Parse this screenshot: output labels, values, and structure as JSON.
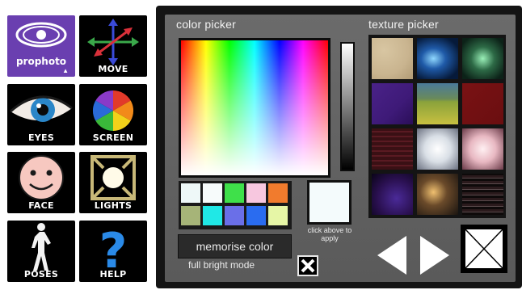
{
  "tools": [
    {
      "id": "prophoto",
      "label": "prophoto",
      "icon": "eye-logo-icon"
    },
    {
      "id": "move",
      "label": "MOVE",
      "icon": "move-arrows-icon"
    },
    {
      "id": "eyes",
      "label": "EYES",
      "icon": "eye-icon"
    },
    {
      "id": "screen",
      "label": "SCREEN",
      "icon": "color-wheel-icon"
    },
    {
      "id": "face",
      "label": "FACE",
      "icon": "smiley-face-icon"
    },
    {
      "id": "lights",
      "label": "LIGHTS",
      "icon": "spotlight-icon"
    },
    {
      "id": "poses",
      "label": "POSES",
      "icon": "figure-icon"
    },
    {
      "id": "help",
      "label": "HELP",
      "icon": "question-mark-icon"
    }
  ],
  "color_picker": {
    "title": "color picker",
    "memorise_label": "memorise color",
    "apply_hint": "click above to apply",
    "bright_mode_label": "full bright mode",
    "selected_color": "#f4fbfc",
    "swatches": [
      "#eef8f8",
      "#f7fbfb",
      "#3fe04a",
      "#f7c7df",
      "#f17b2d",
      "#a6b478",
      "#20e8e6",
      "#6a6fe8",
      "#2a6cf0",
      "#e6f6a6"
    ]
  },
  "texture_picker": {
    "title": "texture picker",
    "textures": [
      {
        "name": "sand",
        "color": "#c9b48f"
      },
      {
        "name": "blue-swirl",
        "color": "#1f5aa8"
      },
      {
        "name": "green-smoke",
        "color": "#2d6a46"
      },
      {
        "name": "purple",
        "color": "#3e1a78"
      },
      {
        "name": "field",
        "color": "#8aa23b"
      },
      {
        "name": "dark-red",
        "color": "#6a0e10"
      },
      {
        "name": "plaid",
        "color": "#3a1014"
      },
      {
        "name": "white-glow",
        "color": "#d9dfe6"
      },
      {
        "name": "pink-glow",
        "color": "#e8b8c2"
      },
      {
        "name": "violet-night",
        "color": "#2a1050"
      },
      {
        "name": "street-light",
        "color": "#6a4a2a"
      },
      {
        "name": "stripes",
        "color": "#2a1a1c"
      }
    ]
  }
}
